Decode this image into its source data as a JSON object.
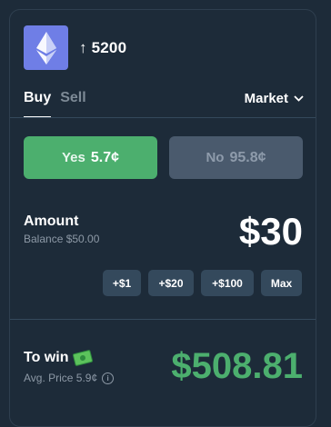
{
  "header": {
    "title": "↑ 5200",
    "logo_icon": "ethereum-icon"
  },
  "tabs": [
    {
      "label": "Buy",
      "active": true
    },
    {
      "label": "Sell",
      "active": false
    }
  ],
  "order_type": {
    "label": "Market",
    "icon": "chevron-down-icon"
  },
  "outcomes": {
    "yes": {
      "label": "Yes",
      "price": "5.7¢"
    },
    "no": {
      "label": "No",
      "price": "95.8¢"
    }
  },
  "amount": {
    "label": "Amount",
    "balance": "Balance $50.00",
    "value": "$30"
  },
  "quick_amounts": [
    "+$1",
    "+$20",
    "+$100",
    "Max"
  ],
  "to_win": {
    "label": "To win",
    "icon": "money-icon",
    "avg_price": "Avg. Price 5.9¢",
    "info_icon": "info-icon",
    "value": "$508.81"
  },
  "colors": {
    "background": "#1d2b39",
    "yes_green": "#4caf6e",
    "no_gray": "#4a5a6d",
    "eth_purple": "#6f7ee6"
  }
}
